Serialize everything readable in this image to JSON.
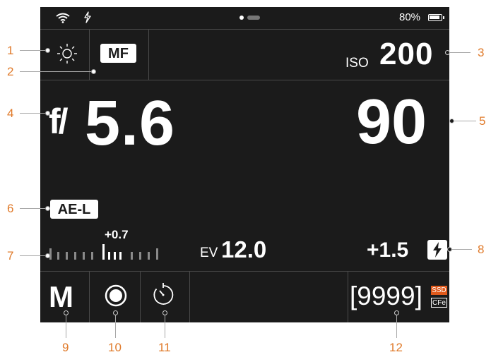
{
  "status_bar": {
    "wifi_icon": "wifi-icon",
    "flash_status_icon": "lightning-icon",
    "battery_percent": "80%",
    "battery_level": 0.8
  },
  "top_row": {
    "white_balance_icon": "sun-icon",
    "focus_mode": "MF",
    "iso_label": "ISO",
    "iso_value": "200"
  },
  "main": {
    "aperture_prefix": "f/",
    "aperture_value": "5.6",
    "shutter_value": "90",
    "ae_lock": "AE-L",
    "exposure_comp": "+0.7",
    "ev_label": "EV",
    "ev_value": "12.0",
    "flash_comp": "+1.5",
    "flash_icon": "flash-icon"
  },
  "bottom_row": {
    "mode": "M",
    "record_icon": "record-icon",
    "timer_icon": "self-timer-icon",
    "shots_remaining": "[9999]",
    "storage_primary": "SSD",
    "storage_secondary": "CFe"
  },
  "callouts": [
    "1",
    "2",
    "3",
    "4",
    "5",
    "6",
    "7",
    "8",
    "9",
    "10",
    "11",
    "12"
  ],
  "colors": {
    "screen": "#1b1b1b",
    "callout": "#e07a2a",
    "ssd_badge": "#e05a1c"
  }
}
